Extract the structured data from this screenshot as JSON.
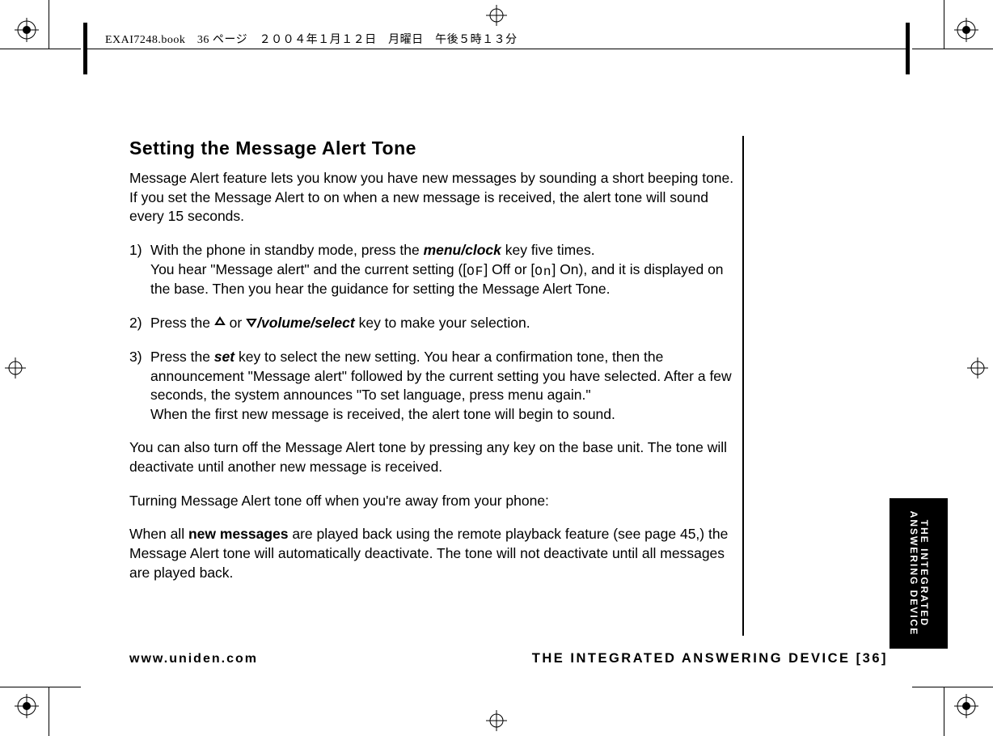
{
  "header": "EXAI7248.book　36 ページ　２００４年１月１２日　月曜日　午後５時１３分",
  "title": "Setting the Message Alert Tone",
  "intro": "Message Alert feature lets you know you have new messages by sounding a short beeping tone. If you set the Message Alert to on when a new message is received, the alert tone will sound every 15 seconds.",
  "step1": {
    "num": "1)",
    "a": "With the phone in standby mode, press the ",
    "key": "menu/clock",
    "b": " key five times.",
    "c": "You hear \"Message alert\" and the current setting ([",
    "off_seg": "OF",
    "d": "] Off or [",
    "on_seg": "On",
    "e": "] On), and it is displayed on the base. Then you hear the guidance for setting the Message Alert Tone."
  },
  "step2": {
    "num": "2)",
    "a": "Press the ",
    "b": " or ",
    "key": "/volume/select",
    "c": " key to make your selection."
  },
  "step3": {
    "num": "3)",
    "a": "Press the ",
    "key": "set",
    "b": " key to select the new setting. You hear a confirmation tone, then the announcement \"Message alert\" followed by the current setting you have selected. After a few seconds, the system announces \"To set language, press menu again.\"",
    "c": "When the first new message is received, the alert tone will begin to sound."
  },
  "p_turnoff": "You can also turn off the Message Alert tone by pressing any key on the base unit. The tone will deactivate until another new message is received.",
  "p_away": "Turning Message Alert tone off when you're away from your phone:",
  "p_remote_a": "When all ",
  "p_remote_bold": "new messages",
  "p_remote_b": " are played back using the remote playback feature (see page 45,) the Message Alert tone will automatically deactivate. The tone will not deactivate until all messages are played back.",
  "side_label": "THE INTEGRATED\nANSWERING DEVICE",
  "footer_url": "www.uniden.com",
  "footer_section": "THE INTEGRATED ANSWERING DEVICE [36]"
}
